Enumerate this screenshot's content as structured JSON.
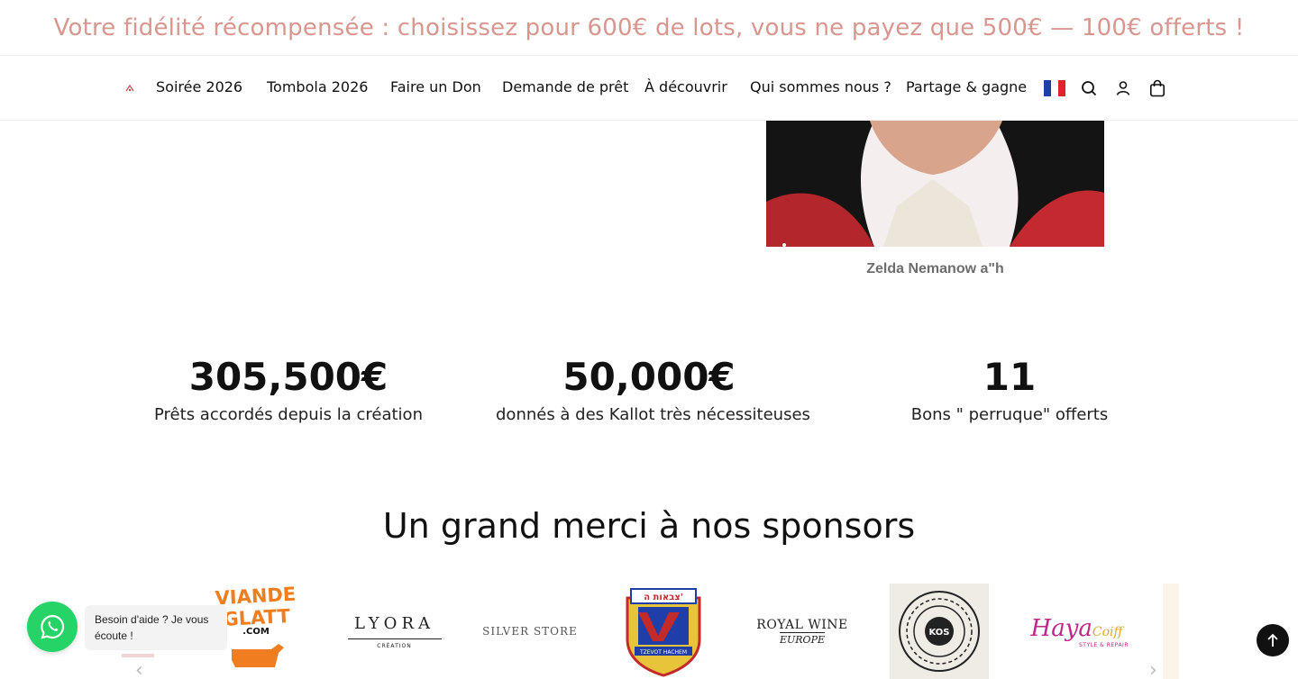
{
  "announcement": {
    "text": "Votre fidélité récompensée : choisissez pour 600€ de lots, vous ne payez que 500€ — 100€ offerts !"
  },
  "nav": {
    "items": [
      {
        "label": "Soirée 2026"
      },
      {
        "label": "Tombola 2026"
      },
      {
        "label": "Faire un Don"
      },
      {
        "label": "Demande de prêt"
      },
      {
        "label": "À découvrir"
      },
      {
        "label": "Qui sommes nous ?"
      },
      {
        "label": "Partage & gagne"
      }
    ],
    "icons": [
      "flag-france-icon",
      "search-icon",
      "account-icon",
      "cart-icon"
    ]
  },
  "portrait": {
    "caption": "Zelda Nemanow a\"h"
  },
  "stats": [
    {
      "value": "305,500€",
      "label": "Prêts accordés depuis la création"
    },
    {
      "value": "50,000€",
      "label": "donnés à des Kallot très nécessiteuses"
    },
    {
      "value": "11",
      "label": "Bons \" perruque\" offerts"
    }
  ],
  "sponsors": {
    "title": "Un grand merci à nos sponsors",
    "logos": [
      {
        "name": "VIANDE GLATT",
        "suffix": ".COM"
      },
      {
        "name": "LYORA",
        "sub": "CRÉATION"
      },
      {
        "name": "SILVER STORE"
      },
      {
        "name": "צבאות ה'",
        "sub": "TZEVOT HACHEM"
      },
      {
        "name": "ROYAL WINE",
        "sub": "EUROPE"
      },
      {
        "name": "KOS"
      },
      {
        "name": "Haya",
        "suffix": "Coiff",
        "sub": "STYLE & REPAIR"
      }
    ]
  },
  "whatsapp": {
    "bubble": "Besoin d'aide ? Je vous écoute !"
  },
  "colors": {
    "announcement": "#d9968f",
    "whatsapp": "#25d366",
    "text": "#111111"
  }
}
